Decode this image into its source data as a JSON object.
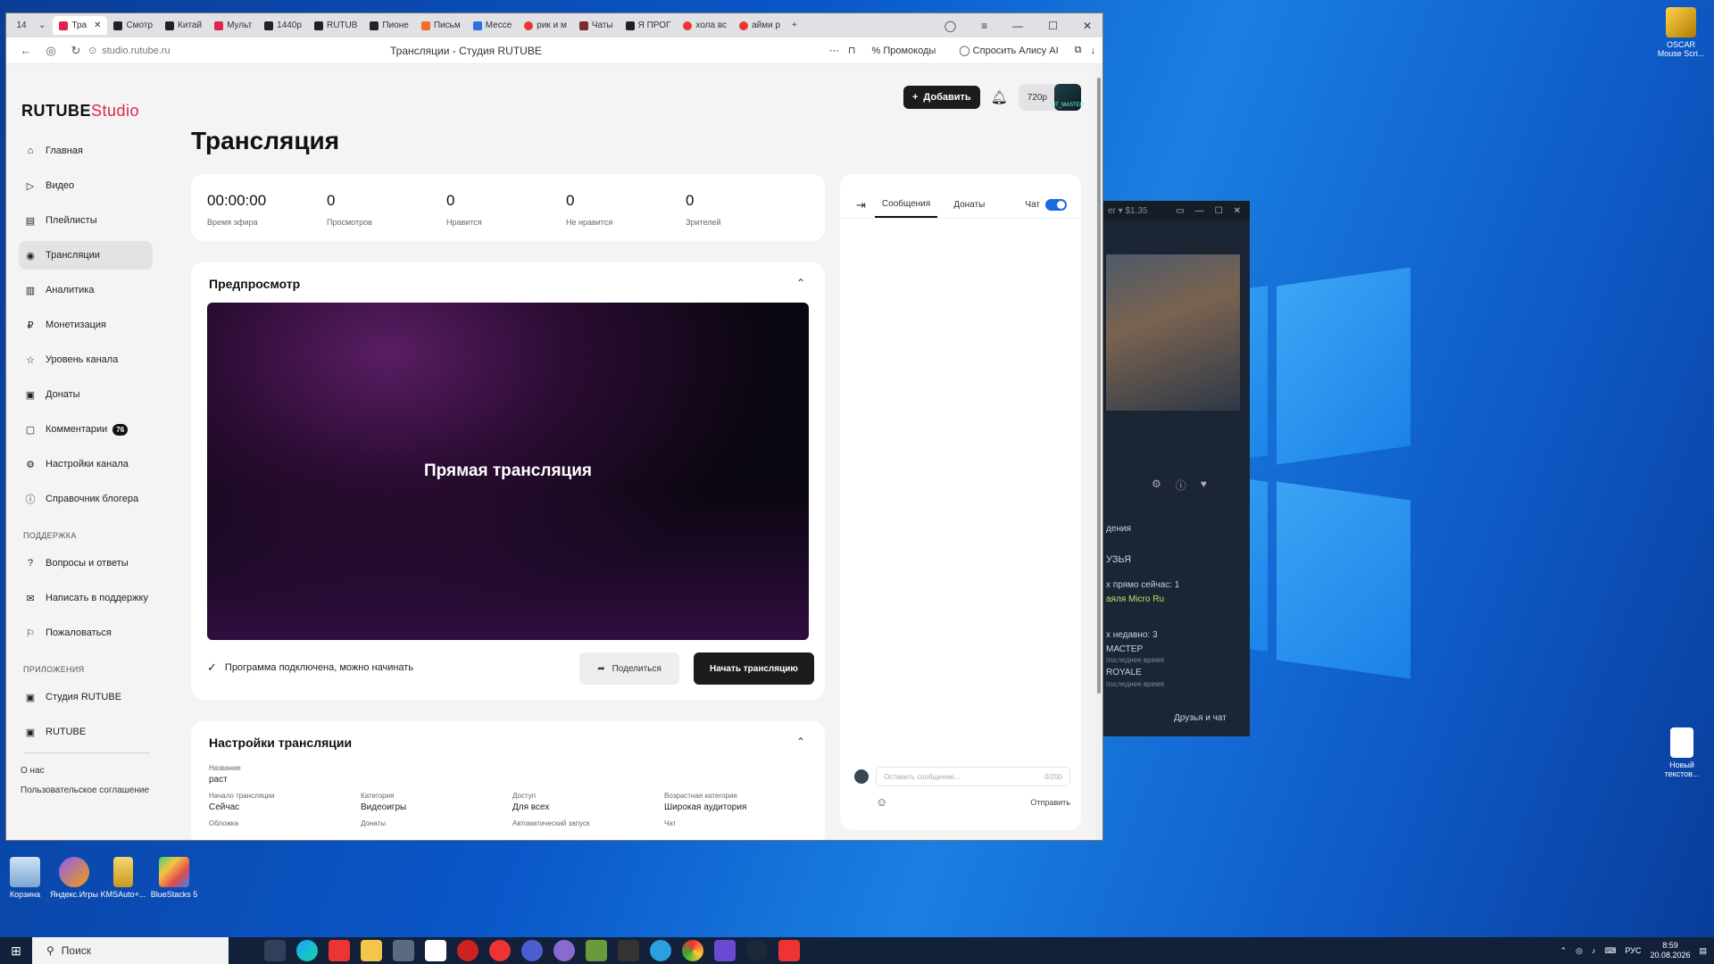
{
  "browser": {
    "tab_count": "14",
    "tabs": [
      "Тра",
      "Смотр",
      "Китай",
      "Мульт",
      "1440р",
      "RUTUB",
      "Пионе",
      "Письм",
      "Мессе",
      "рик и м",
      "Чаты",
      "Я ПРОГ",
      "хола вс",
      "айми р"
    ],
    "url": "studio.rutube.ru",
    "page_title": "Трансляции - Студия RUTUBE",
    "promo": "Промокоды",
    "alice": "Спросить Алису AI"
  },
  "site": {
    "logo_main": "RUTUBE",
    "logo_studio": "Studio",
    "add_button": "Добавить",
    "quality": "720p",
    "avatar_text": "HT_MASTER",
    "page_title": "Трансляция"
  },
  "sidebar": {
    "items": [
      {
        "label": "Главная",
        "icon": "home-icon"
      },
      {
        "label": "Видео",
        "icon": "video-icon"
      },
      {
        "label": "Плейлисты",
        "icon": "playlist-icon"
      },
      {
        "label": "Трансляции",
        "icon": "broadcast-icon"
      },
      {
        "label": "Аналитика",
        "icon": "analytics-icon"
      },
      {
        "label": "Монетизация",
        "icon": "ruble-icon"
      },
      {
        "label": "Уровень канала",
        "icon": "star-icon"
      },
      {
        "label": "Донаты",
        "icon": "gift-icon"
      },
      {
        "label": "Комментарии",
        "icon": "comment-icon",
        "badge": "76"
      },
      {
        "label": "Настройки канала",
        "icon": "gear-icon"
      },
      {
        "label": "Справочник блогера",
        "icon": "info-icon"
      }
    ],
    "support_title": "ПОДДЕРЖКА",
    "support": [
      {
        "label": "Вопросы и ответы",
        "icon": "question-icon"
      },
      {
        "label": "Написать в поддержку",
        "icon": "mail-icon"
      },
      {
        "label": "Пожаловаться",
        "icon": "flag-icon"
      }
    ],
    "apps_title": "ПРИЛОЖЕНИЯ",
    "apps": [
      {
        "label": "Студия RUTUBE",
        "icon": "studio-app-icon"
      },
      {
        "label": "RUTUBE",
        "icon": "rutube-app-icon"
      }
    ],
    "footer": [
      "О нас",
      "Пользовательское соглашение"
    ]
  },
  "stats": [
    {
      "value": "00:00:00",
      "label": "Время эфира"
    },
    {
      "value": "0",
      "label": "Просмотров"
    },
    {
      "value": "0",
      "label": "Нравится"
    },
    {
      "value": "0",
      "label": "Не нравится"
    },
    {
      "value": "0",
      "label": "Зрителей"
    }
  ],
  "preview": {
    "title": "Предпросмотр",
    "video_label": "Прямая трансляция",
    "status": "Программа подключена, можно начинать",
    "share": "Поделиться",
    "start": "Начать трансляцию"
  },
  "settings": {
    "title": "Настройки трансляции",
    "name_label": "Название",
    "name_value": "раст",
    "row2": [
      {
        "label": "Начало трансляции",
        "value": "Сейчас"
      },
      {
        "label": "Категория",
        "value": "Видеоигры"
      },
      {
        "label": "Доступ",
        "value": "Для всех"
      },
      {
        "label": "Возрастная категория",
        "value": "Широкая аудитория"
      }
    ],
    "row3": [
      "Обложка",
      "Донаты",
      "Автоматический запуск",
      "Чат"
    ]
  },
  "chat": {
    "tab_messages": "Сообщения",
    "tab_donates": "Донаты",
    "toggle_label": "Чат",
    "placeholder": "Оставить сообщение...",
    "counter": "0/200",
    "send": "Отправить"
  },
  "steam": {
    "price": "er ▾ $1.35",
    "line1": "дения",
    "line2": "УЗЬЯ",
    "line3": "х прямо сейчас: 1",
    "line4": "аяля Micro Ru",
    "line5": "х недавно: 3",
    "line6": "МАСТЕР",
    "line7": "последнее время",
    "line8": "ROYALE",
    "line9": "последнее время",
    "footer": "Друзья и чат"
  },
  "desktop": {
    "icons": [
      "Корзина",
      "Яндекс.Игры",
      "KMSAuto+...",
      "BlueStacks 5"
    ],
    "right_icon1": "OSCAR Mouse Scri...",
    "right_icon2": "Новый текстов..."
  },
  "taskbar": {
    "search": "Поиск",
    "lang": "РУС",
    "time": "8:59",
    "date": "20.08.2026"
  }
}
